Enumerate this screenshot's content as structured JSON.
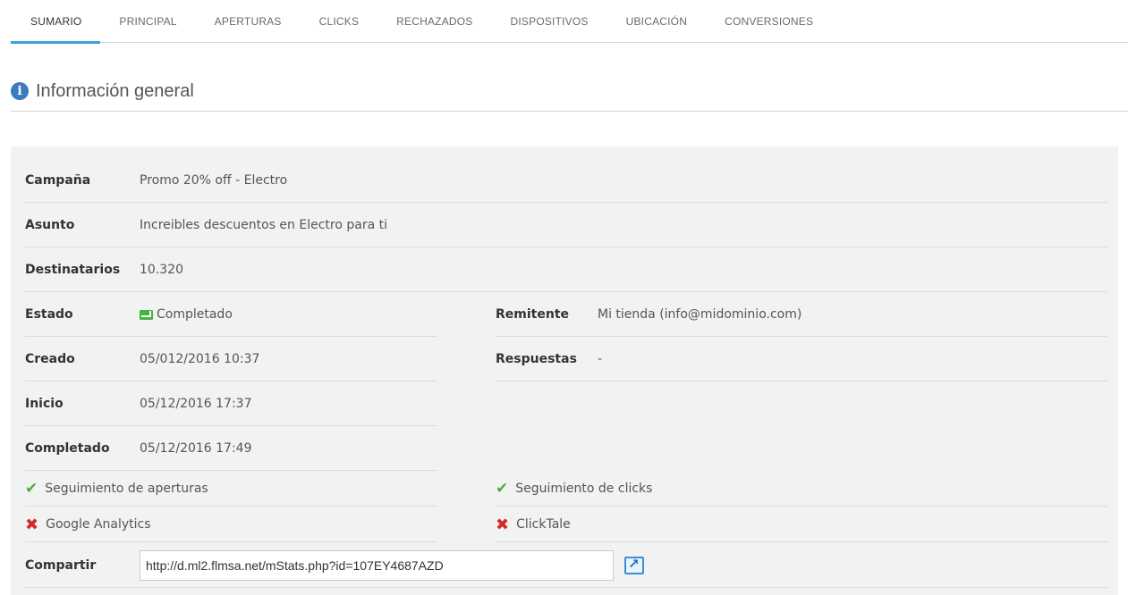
{
  "tabs": [
    {
      "label": "SUMARIO",
      "active": true
    },
    {
      "label": "PRINCIPAL",
      "active": false
    },
    {
      "label": "APERTURAS",
      "active": false
    },
    {
      "label": "CLICKS",
      "active": false
    },
    {
      "label": "RECHAZADOS",
      "active": false
    },
    {
      "label": "DISPOSITIVOS",
      "active": false
    },
    {
      "label": "UBICACIÓN",
      "active": false
    },
    {
      "label": "CONVERSIONES",
      "active": false
    }
  ],
  "section": {
    "title": "Información general",
    "icon": "info-circle-icon"
  },
  "info": {
    "campana_label": "Campaña",
    "campana_value": "Promo 20% off - Electro",
    "asunto_label": "Asunto",
    "asunto_value": "Increibles descuentos en Electro para ti",
    "destinatarios_label": "Destinatarios",
    "destinatarios_value": "10.320",
    "estado_label": "Estado",
    "estado_value": "Completado",
    "creado_label": "Creado",
    "creado_value": "05/012/2016 10:37",
    "inicio_label": "Inicio",
    "inicio_value": "05/12/2016 17:37",
    "completado_label": "Completado",
    "completado_value": "05/12/2016 17:49",
    "remitente_label": "Remitente",
    "remitente_value": "Mi tienda (info@midominio.com)",
    "respuestas_label": "Respuestas",
    "respuestas_value": "-"
  },
  "tracking": {
    "aperturas": "Seguimiento de aperturas",
    "clicks": "Seguimiento de clicks",
    "analytics": "Google Analytics",
    "clicktale": "ClickTale"
  },
  "share": {
    "label": "Compartir",
    "url": "http://d.ml2.flmsa.net/mStats.php?id=107EY4687AZD"
  },
  "colors": {
    "accent": "#3da0da",
    "panel": "#f1f2f2",
    "check": "#4caf3a",
    "cross": "#d62a2a"
  }
}
